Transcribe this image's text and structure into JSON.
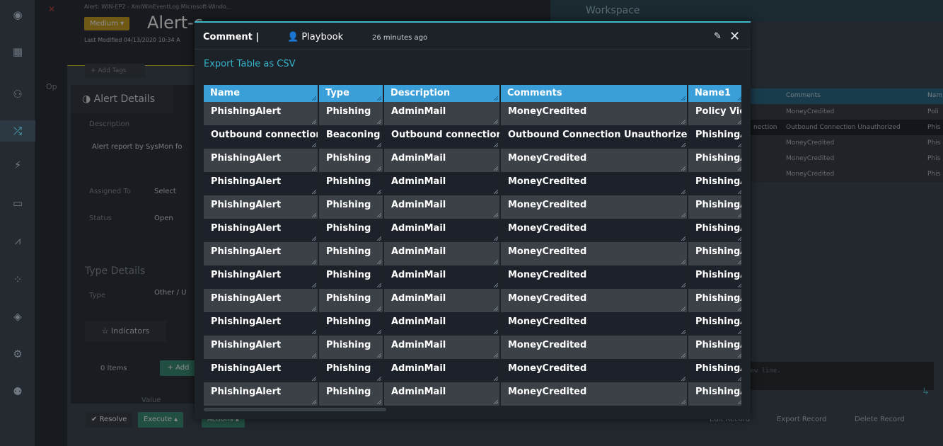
{
  "background": {
    "alert_subtitle": "Alert: WIN-EP2 - XmlWinEventLog:Microsoft-Windo...",
    "severity": "Medium",
    "alert_title": "Alert-c",
    "last_modified": "Last Modified 04/13/2020 10:34 A",
    "add_tags": "+ Add Tags",
    "ops_label": "Op",
    "details_tab": "Alert Details",
    "description_label": "Description",
    "description_value": "Alert report by SysMon fo",
    "assigned_to_label": "Assigned To",
    "assigned_to_value": "Select",
    "status_label": "Status",
    "status_value": "Open",
    "type_details": "Type Details",
    "type_label": "Type",
    "type_value": "Other / U",
    "indicators_tab": "Indicators",
    "items_count": "0 Items",
    "add_button": "+ Add",
    "value_col": "Value",
    "resolve": "Resolve",
    "execute": "Execute",
    "actions": "Actions",
    "workspace_title": "Workspace",
    "ws_headers": [
      "Comments",
      "Nam"
    ],
    "ws_rows": [
      [
        "MoneyCredited",
        "Poli"
      ],
      [
        "nection",
        "Outbound Connection Unauthorized",
        "Phis"
      ],
      [
        "MoneyCredited",
        "Phis"
      ],
      [
        "MoneyCredited",
        "Phis"
      ],
      [
        "MoneyCredited",
        "Phis"
      ]
    ],
    "ws_placeholder": "new line.",
    "edit_record": "Edit Record",
    "export_record": "Export Record",
    "delete_record": "Delete Record"
  },
  "modal": {
    "title": "Comment |",
    "user": "Playbook",
    "time": "26 minutes ago",
    "export_link": "Export Table as CSV",
    "columns": [
      "Name",
      "Type",
      "Description",
      "Comments",
      "Name1"
    ],
    "rows": [
      [
        "PhishingAlert",
        "Phishing",
        "AdminMail",
        "MoneyCredited",
        "Policy Vic"
      ],
      [
        "Outbound connection",
        "Beaconing",
        "Outbound connection",
        "Outbound Connection Unauthorized",
        "PhishingA"
      ],
      [
        "PhishingAlert",
        "Phishing",
        "AdminMail",
        "MoneyCredited",
        "PhishingA"
      ],
      [
        "PhishingAlert",
        "Phishing",
        "AdminMail",
        "MoneyCredited",
        "PhishingA"
      ],
      [
        "PhishingAlert",
        "Phishing",
        "AdminMail",
        "MoneyCredited",
        "PhishingA"
      ],
      [
        "PhishingAlert",
        "Phishing",
        "AdminMail",
        "MoneyCredited",
        "PhishingA"
      ],
      [
        "PhishingAlert",
        "Phishing",
        "AdminMail",
        "MoneyCredited",
        "PhishingA"
      ],
      [
        "PhishingAlert",
        "Phishing",
        "AdminMail",
        "MoneyCredited",
        "PhishingA"
      ],
      [
        "PhishingAlert",
        "Phishing",
        "AdminMail",
        "MoneyCredited",
        "PhishingA"
      ],
      [
        "PhishingAlert",
        "Phishing",
        "AdminMail",
        "MoneyCredited",
        "PhishingA"
      ],
      [
        "PhishingAlert",
        "Phishing",
        "AdminMail",
        "MoneyCredited",
        "PhishingA"
      ],
      [
        "PhishingAlert",
        "Phishing",
        "AdminMail",
        "MoneyCredited",
        "PhishingA"
      ],
      [
        "PhishingAlert",
        "Phishing",
        "AdminMail",
        "MoneyCredited",
        "PhishingA"
      ]
    ]
  },
  "colors": {
    "accent": "#3fb9cc",
    "header": "#3a9fd8",
    "severity": "#c9a226"
  }
}
